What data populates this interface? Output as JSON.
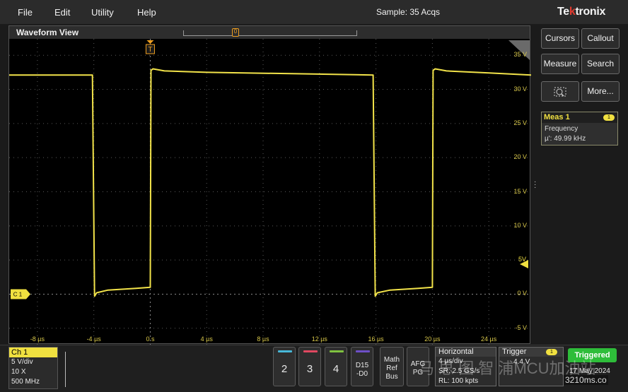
{
  "menu": {
    "items": [
      "File",
      "Edit",
      "Utility",
      "Help"
    ],
    "status": "Sample: 35 Acqs",
    "brand_a": "Te",
    "brand_k": "k",
    "brand_b": "tronix"
  },
  "waveform_view": {
    "title": "Waveform View",
    "zoom_marker": "0",
    "trigger_marker": "T",
    "channel_marker": "C 1"
  },
  "chart_data": {
    "type": "line",
    "x_unit": "µs",
    "y_unit": "V",
    "xlim": [
      -10,
      27
    ],
    "ylim": [
      -7.4,
      37.4
    ],
    "x_ticks": [
      "-8 µs",
      "-4 µs",
      "0 s",
      "4 µs",
      "8 µs",
      "12 µs",
      "16 µs",
      "20 µs",
      "24 µs"
    ],
    "y_ticks": [
      "35 V",
      "30 V",
      "25 V",
      "20 V",
      "15 V",
      "10 V",
      "5 V",
      "0 V",
      "-5 V"
    ],
    "trigger_level_label": "5V",
    "series": [
      {
        "color": "#f2e34a",
        "points": [
          [
            -10,
            32.1
          ],
          [
            -4.1,
            32.1
          ],
          [
            -3.95,
            -0.3
          ],
          [
            -3.8,
            0.2
          ],
          [
            -3.0,
            0.6
          ],
          [
            -1.0,
            0.85
          ],
          [
            0.0,
            1.0
          ],
          [
            0.05,
            32.8
          ],
          [
            0.2,
            33.0
          ],
          [
            1.0,
            32.7
          ],
          [
            4.0,
            32.5
          ],
          [
            10.0,
            32.3
          ],
          [
            15.8,
            32.1
          ],
          [
            15.95,
            -0.3
          ],
          [
            16.1,
            0.2
          ],
          [
            17.0,
            0.6
          ],
          [
            19.0,
            0.85
          ],
          [
            20.0,
            1.0
          ],
          [
            20.05,
            32.8
          ],
          [
            20.2,
            33.0
          ],
          [
            21.0,
            32.7
          ],
          [
            24.0,
            32.4
          ],
          [
            27.0,
            32.1
          ]
        ]
      }
    ],
    "grid": true
  },
  "side": {
    "cursors": "Cursors",
    "callout": "Callout",
    "measure": "Measure",
    "search": "Search",
    "more": "More..."
  },
  "measurement": {
    "title": "Meas 1",
    "badge": "1",
    "name": "Frequency",
    "value": "µ': 49.99 kHz"
  },
  "ch1": {
    "title": "Ch 1",
    "scale": "5 V/div",
    "probe": "10 X",
    "bandwidth": "500 MHz"
  },
  "channels": [
    {
      "label": "2",
      "color": "#48b8d8"
    },
    {
      "label": "3",
      "color": "#e04860"
    },
    {
      "label": "4",
      "color": "#7fc240"
    }
  ],
  "digital": {
    "line1": "D15",
    "line2": "-D0",
    "color": "#6e50c8"
  },
  "math": {
    "line1": "Math",
    "line2": "Ref",
    "line3": "Bus"
  },
  "afg": {
    "line1": "AFG",
    "line2": "PG"
  },
  "horizontal": {
    "title": "Horizontal",
    "scale": "4 µs/div",
    "sample_rate": "SR: 2.5 GS/s",
    "record_length": "RL: 100 kpts"
  },
  "trigger": {
    "title": "Trigger",
    "badge": "1",
    "level": "4.4 V"
  },
  "acq": {
    "state": "Triggered",
    "date": "17 May 2024"
  },
  "watermark": {
    "text": "马 思 图 智 浦MCU加油站",
    "site": "3210ms.co"
  }
}
